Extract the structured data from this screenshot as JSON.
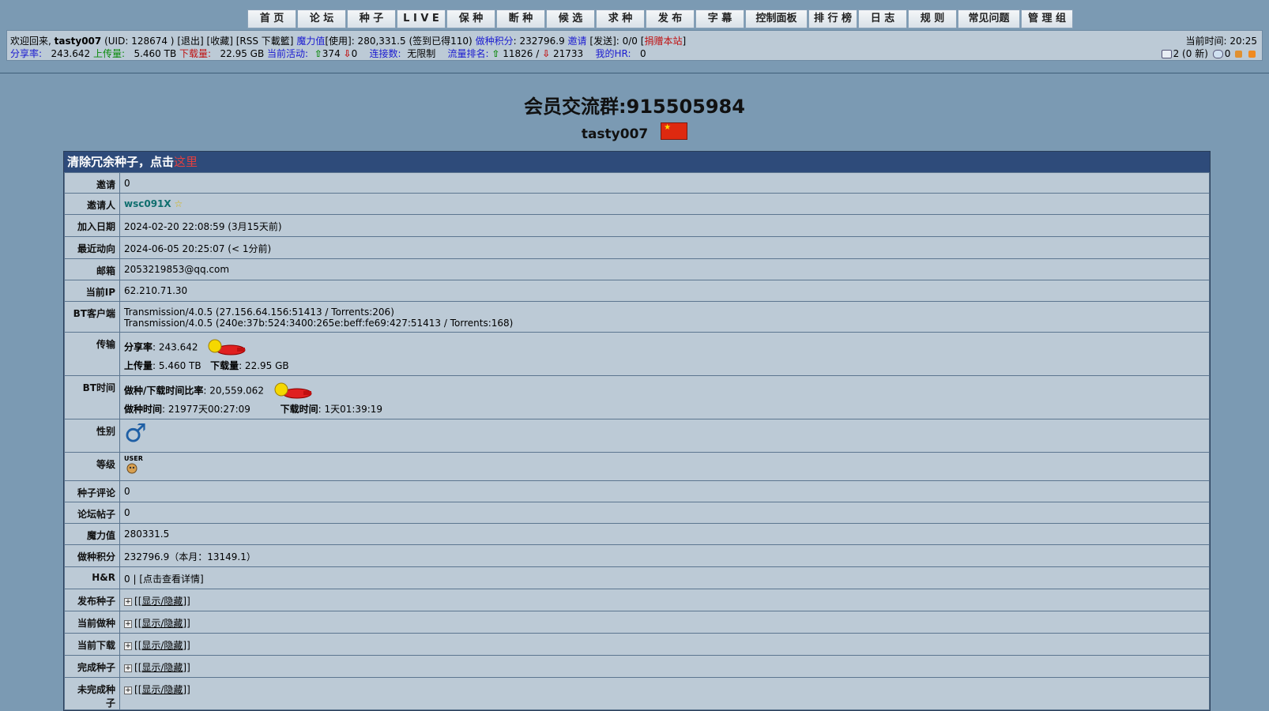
{
  "nav": [
    {
      "label": "首 页",
      "w": 60
    },
    {
      "label": "论 坛",
      "w": 60
    },
    {
      "label": "种 子",
      "w": 60
    },
    {
      "label": "L I V E",
      "w": 60
    },
    {
      "label": "保 种",
      "w": 60
    },
    {
      "label": "断 种",
      "w": 60
    },
    {
      "label": "候 选",
      "w": 60
    },
    {
      "label": "求 种",
      "w": 60
    },
    {
      "label": "发 布",
      "w": 60
    },
    {
      "label": "字 幕",
      "w": 60
    },
    {
      "label": "控制面板",
      "w": 77
    },
    {
      "label": "排 行 榜",
      "w": 60
    },
    {
      "label": "日 志",
      "w": 60
    },
    {
      "label": "规 则",
      "w": 60
    },
    {
      "label": "常见问题",
      "w": 77
    },
    {
      "label": "管 理 组",
      "w": 64
    }
  ],
  "infobar": {
    "welcome": "欢迎回来,",
    "username": "tasty007",
    "uid": "(UID: 128674 )",
    "logout": "[退出]",
    "favorites": "[收藏]",
    "rss": "[RSS 下載籃]",
    "bonus_label": "魔力值",
    "bonus_use": "[使用]",
    "bonus_value": ": 280,331.5",
    "signin": "(签到已得110)",
    "seed_points_label": "做种积分",
    "seed_points_value": ": 232796.9",
    "invite_label": "邀请",
    "invite_send": "[发送]",
    "invite_value": ": 0/0",
    "donate": "捐赠本站",
    "ratio_label": "分享率:",
    "ratio_value": "243.642",
    "upload_label": "上传量:",
    "upload_value": "5.460 TB",
    "download_label": "下载量:",
    "download_value": "22.95 GB",
    "activity_label": "当前活动:",
    "seeding_count": "374",
    "leeching_count": "0",
    "connect_label": "连接数:",
    "connect_value": "无限制",
    "rank_label": "流量排名:",
    "rank_up": "11826",
    "rank_sep": "/",
    "rank_down": "21733",
    "hr_label": "我的HR:",
    "hr_value": "0",
    "time_label": "当前时间:",
    "time_value": "20:25",
    "messages": "2 (0 新)",
    "friends": "0"
  },
  "group_title": "会员交流群:915505984",
  "user_heading": "tasty007",
  "panel": {
    "header_text": "清除冗余种子，点击",
    "header_link": "这里"
  },
  "rows": {
    "invite": {
      "k": "邀请",
      "v": "0"
    },
    "inviter": {
      "k": "邀请人",
      "v": "wsc091X"
    },
    "join": {
      "k": "加入日期",
      "v": "2024-02-20 22:08:59 (3月15天前)"
    },
    "last": {
      "k": "最近动向",
      "v": "2024-06-05 20:25:07 (< 1分前)"
    },
    "email": {
      "k": "邮箱",
      "v": "2053219853@qq.com"
    },
    "ip": {
      "k": "当前IP",
      "v": "62.210.71.30"
    },
    "client": {
      "k": "BT客户端",
      "v1": "Transmission/4.0.5 (27.156.64.156:51413 / Torrents:206)",
      "v2": "Transmission/4.0.5 (240e:37b:524:3400:265e:beff:fe69:427:51413 / Torrents:168)"
    },
    "transfer": {
      "k": "传输",
      "ratio_l": "分享率",
      "ratio_v": ": 243.642",
      "up_l": "上传量",
      "up_v": ": 5.460 TB",
      "down_l": "下载量",
      "down_v": ": 22.95 GB"
    },
    "bttime": {
      "k": "BT时间",
      "r_l": "做种/下载时间比率",
      "r_v": ": 20,559.062",
      "s_l": "做种时间",
      "s_v": ": 21977天00:27:09",
      "d_l": "下载时间",
      "d_v": ": 1天01:39:19"
    },
    "gender": {
      "k": "性别",
      "v": "♂"
    },
    "class": {
      "k": "等级",
      "v": "USER"
    },
    "comments": {
      "k": "种子评论",
      "v": "0"
    },
    "posts": {
      "k": "论坛帖子",
      "v": "0"
    },
    "bonus": {
      "k": "魔力值",
      "v": "280331.5"
    },
    "seedpts": {
      "k": "做种积分",
      "v": "232796.9（本月：13149.1）"
    },
    "hr": {
      "k": "H&R",
      "v0": "0 | ",
      "v1": "[点击查看详情]"
    },
    "uploaded": {
      "k": "发布种子",
      "v": "[显示/隐藏]"
    },
    "seeding": {
      "k": "当前做种",
      "v": "[显示/隐藏]"
    },
    "leeching": {
      "k": "当前下载",
      "v": "[显示/隐藏]"
    },
    "completed": {
      "k": "完成种子",
      "v": "[显示/隐藏]"
    },
    "incomplete": {
      "k": "未完成种子",
      "v": "[显示/隐藏]"
    }
  }
}
